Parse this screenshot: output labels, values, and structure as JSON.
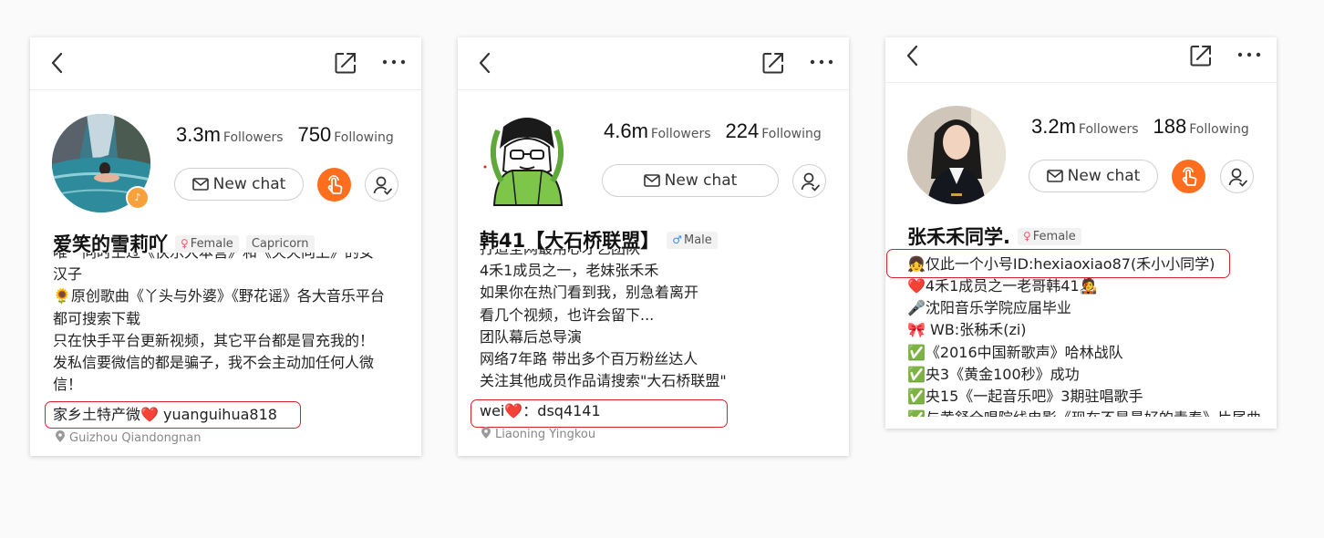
{
  "cards": [
    {
      "stats": {
        "followers": "3.3m",
        "followers_label": "Followers",
        "following": "750",
        "following_label": "Following"
      },
      "new_chat_label": "New chat",
      "name": "爱笑的雪莉吖",
      "gender_tag": "Female",
      "zodiac_tag": "Capricorn",
      "bio_lines": [
        "唯一同时上过《快乐大本营》和《天天向上》的女",
        "汉子",
        "🌻原创歌曲《丫头与外婆》《野花谣》各大音乐平台",
        "都可搜索下载",
        "只在快手平台更新视频，其它平台都是冒充我的！",
        "发私信要微信的都是骗子，我不会主动加任何人微",
        "信！"
      ],
      "contact_line": "家乡土特产微❤️   yuanguihua818",
      "location": "Guizhou Qiandongnan"
    },
    {
      "stats": {
        "followers": "4.6m",
        "followers_label": "Followers",
        "following": "224",
        "following_label": "Following"
      },
      "new_chat_label": "New chat",
      "name": "韩41【大石桥联盟】",
      "gender_tag": "Male",
      "bio_lines": [
        "打造全网最用心才艺团队",
        "4禾1成员之一，老妹张禾禾",
        "如果你在热门看到我，别急着离开",
        "看几个视频，也许会留下...",
        "团队幕后总导演",
        "网络7年路 带出多个百万粉丝达人",
        "关注其他成员作品请搜索\"大石桥联盟\""
      ],
      "contact_line": "wei❤️：dsq4141",
      "location": "Liaoning Yingkou"
    },
    {
      "stats": {
        "followers": "3.2m",
        "followers_label": "Followers",
        "following": "188",
        "following_label": "Following"
      },
      "new_chat_label": "New chat",
      "name": "张禾禾同学.",
      "gender_tag": "Female",
      "contact_line": "👧仅此一个小号ID:hexiaoxiao87(禾小小同学)",
      "bio_lines": [
        "❤️4禾1成员之一老哥韩41🧑‍🎤",
        "🎤沈阳音乐学院应届毕业",
        "🎀 WB:张秭禾(zi)",
        "✅《2016中国新歌声》哈林战队",
        "✅央3《黄金100秒》成功",
        "✅央15《一起音乐吧》3期驻唱歌手",
        "✅与黄舒全唱院线电影《现在不是最好的青春》片尾曲"
      ]
    }
  ],
  "colors": {
    "accent": "#ff6d1f",
    "highlight": "#d7232e",
    "female": "#f05a6c",
    "male": "#3a8ee6"
  },
  "icons": [
    "back-arrow-icon",
    "share-icon",
    "more-icon",
    "mail-icon",
    "touch-icon",
    "follow-icon",
    "music-note-icon",
    "location-pin-icon"
  ]
}
